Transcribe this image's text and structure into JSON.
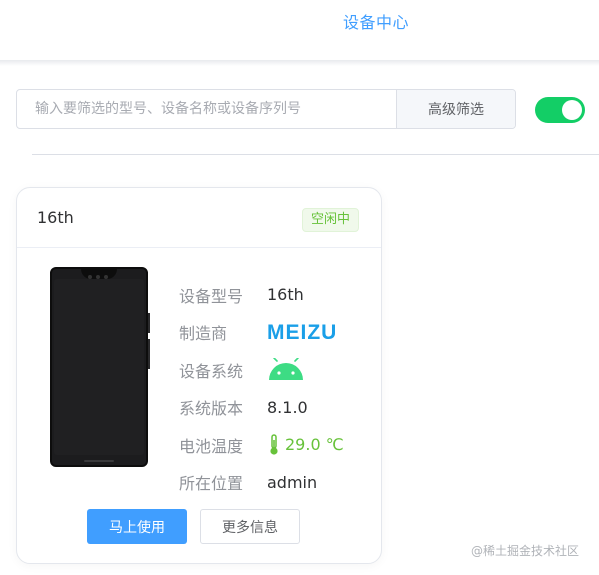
{
  "header": {
    "title": "设备中心"
  },
  "search": {
    "placeholder": "输入要筛选的型号、设备名称或设备序列号",
    "value": "",
    "advanced_label": "高级筛选"
  },
  "toggle": {
    "on": true,
    "color": "#13ce66"
  },
  "device": {
    "name": "16th",
    "status": "空闲中",
    "fields": [
      {
        "label": "设备型号",
        "value": "16th"
      },
      {
        "label": "制造商",
        "value": "MEIZU"
      },
      {
        "label": "设备系统",
        "icon": "android-icon"
      },
      {
        "label": "系统版本",
        "value": "8.1.0"
      },
      {
        "label": "电池温度",
        "value": "29.0 ℃",
        "icon": "thermometer-icon"
      },
      {
        "label": "所在位置",
        "value": "admin"
      }
    ],
    "use_button": "马上使用",
    "more_button": "更多信息"
  },
  "watermark": "@稀土掘金技术社区",
  "colors": {
    "accent": "#409eff",
    "success": "#67c23a",
    "meizu": "#1a9fe8",
    "android": "#3ddc84"
  }
}
